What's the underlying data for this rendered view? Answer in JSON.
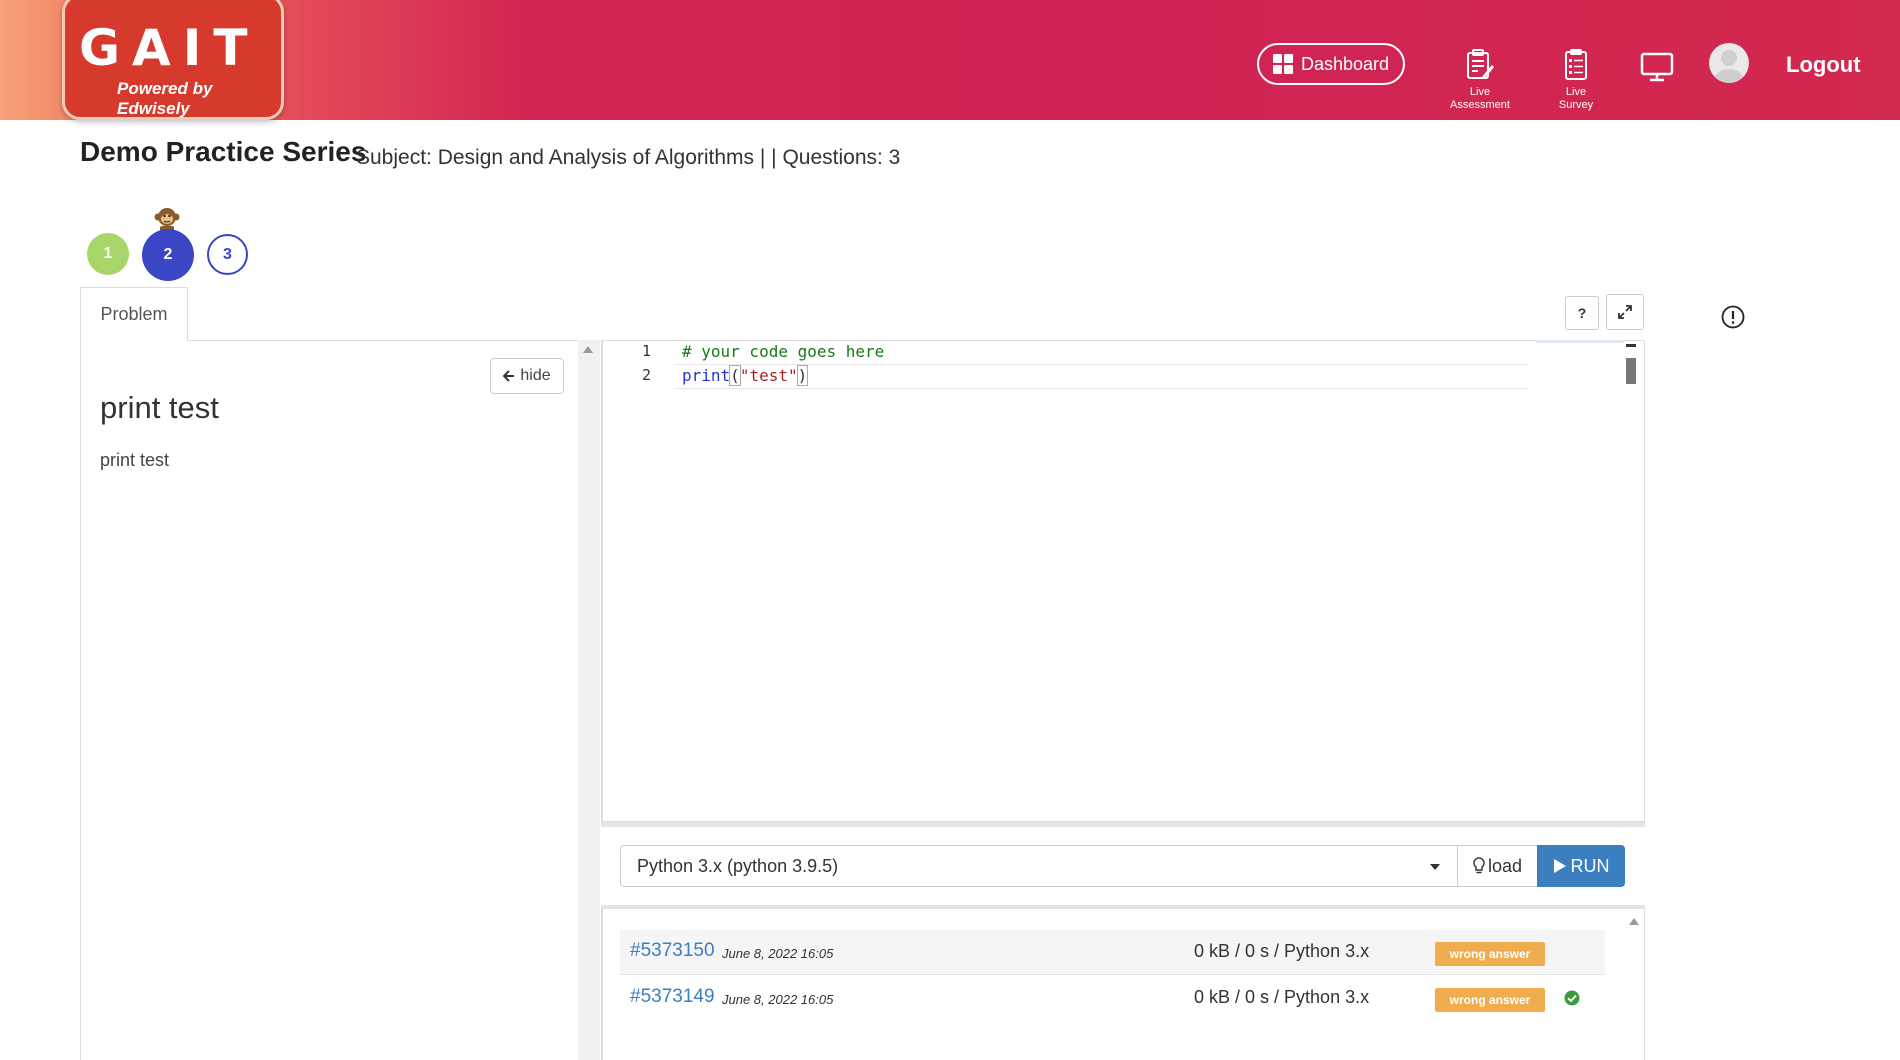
{
  "header": {
    "logo_title": "GAIT",
    "logo_subtitle": "Powered by Edwisely",
    "dashboard_label": "Dashboard",
    "live_assessment_label_1": "Live",
    "live_assessment_label_2": "Assessment",
    "live_survey_label_1": "Live",
    "live_survey_label_2": "Survey",
    "logout_label": "Logout"
  },
  "page": {
    "series_title": "Demo Practice Series",
    "subject_line": "Subject: Design and Analysis of Algorithms | | Questions: 3"
  },
  "questions": [
    {
      "number": "1",
      "state": "answered",
      "color": "#a6d66a"
    },
    {
      "number": "2",
      "state": "current",
      "color": "#3a46c4"
    },
    {
      "number": "3",
      "state": "unvisited",
      "color": "#ffffff"
    }
  ],
  "problem": {
    "tab_label": "Problem",
    "hide_label": "hide",
    "title": "print test",
    "description": "print test"
  },
  "editor": {
    "toolbar": {
      "help_label": "?"
    },
    "lines": [
      {
        "number": "1",
        "comment": "# your code goes here"
      },
      {
        "number": "2",
        "fn": "print",
        "open": "(",
        "string": "\"test\"",
        "close": ")"
      }
    ]
  },
  "runbar": {
    "language": "Python 3.x (python 3.9.5)",
    "load_label": "load",
    "run_label": "RUN"
  },
  "submissions": [
    {
      "id": "#5373150",
      "date": "June 8, 2022 16:05",
      "stats": "0 kB / 0 s / Python 3.x",
      "status": "wrong answer"
    },
    {
      "id": "#5373149",
      "date": "June 8, 2022 16:05",
      "stats": "0 kB / 0 s / Python 3.x",
      "status": "wrong answer"
    }
  ],
  "colors": {
    "header_accent": "#d22452",
    "run_button": "#3b7fc1",
    "badge_warning": "#f0ad4e",
    "check_green": "#3c9a3c"
  }
}
